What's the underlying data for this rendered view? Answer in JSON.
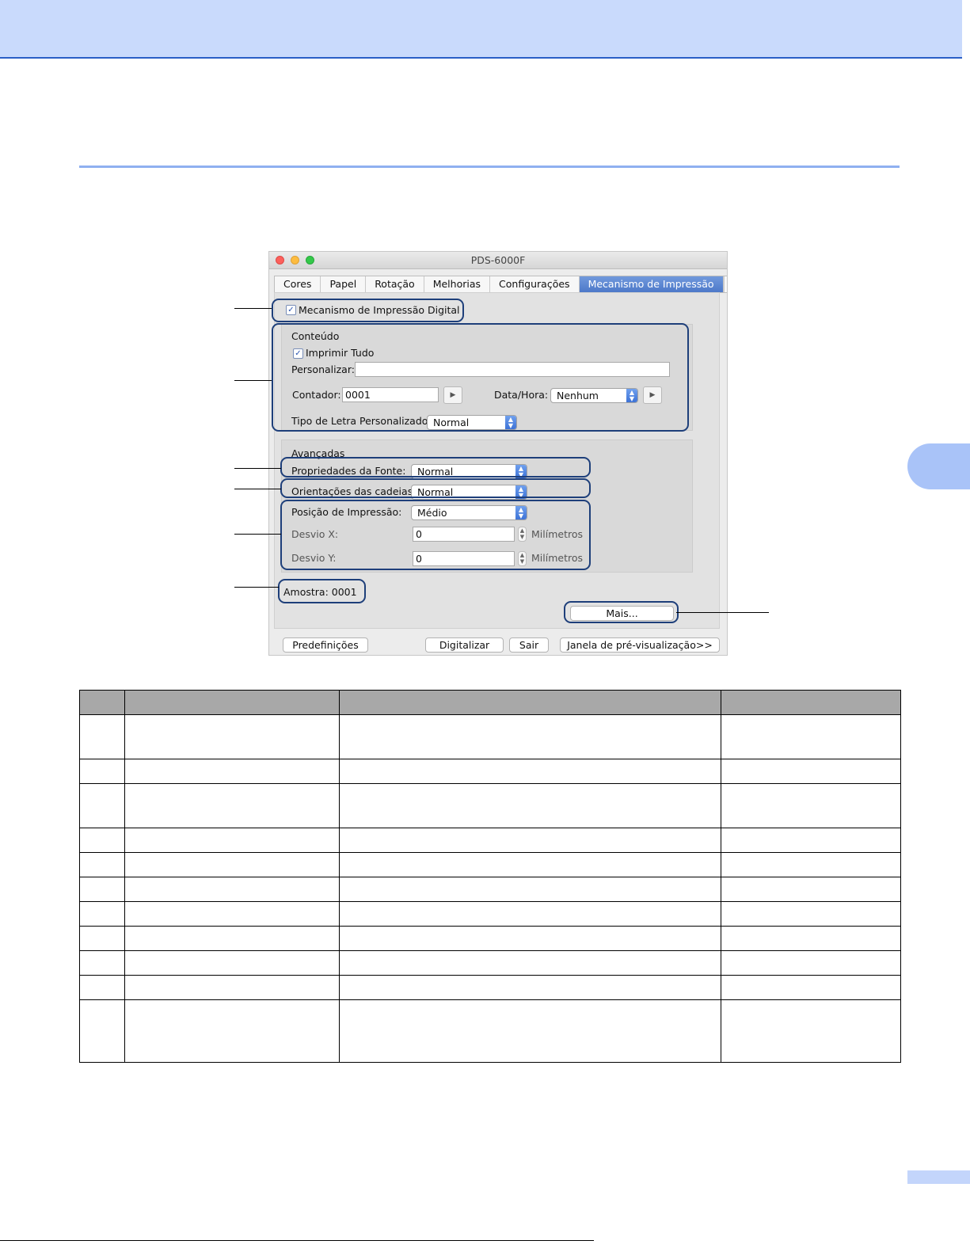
{
  "window": {
    "title": "PDS-6000F"
  },
  "tabs": [
    "Cores",
    "Papel",
    "Rotação",
    "Melhorias",
    "Configurações",
    "Mecanismo de Impressão"
  ],
  "active_tab": "Mecanismo de Impressão",
  "tab_nav": {
    "prev": "◀",
    "next": "▶"
  },
  "imprinter": {
    "enable_label": "Mecanismo de Impressão Digital",
    "enable_checked": true,
    "content": {
      "title": "Conteúdo",
      "print_all_label": "Imprimir Tudo",
      "print_all_checked": true,
      "custom_label": "Personalizar:",
      "custom_value": "",
      "counter_label": "Contador:",
      "counter_value": "0001",
      "datetime_label": "Data/Hora:",
      "datetime_value": "Nenhum",
      "font_label": "Tipo de Letra Personalizado:",
      "font_value": "Normal"
    },
    "advanced": {
      "title": "Avançadas",
      "font_props_label": "Propriedades da Fonte:",
      "font_props_value": "Normal",
      "orientation_label": "Orientações das cadeias:",
      "orientation_value": "Normal",
      "position_label": "Posição de Impressão:",
      "position_value": "Médio",
      "offset_x_label": "Desvio X:",
      "offset_x_value": "0",
      "offset_y_label": "Desvio Y:",
      "offset_y_value": "0",
      "unit": "Milímetros"
    },
    "sample": "Amostra:  0001",
    "more_button": "Mais..."
  },
  "footer_buttons": {
    "presets": "Predefinições",
    "scan": "Digitalizar",
    "quit": "Sair",
    "preview": "Janela de pré-visualização>>"
  },
  "table": {
    "header_color": "#a8a8a8",
    "rows": 11
  },
  "colors": {
    "top_band": "#c9dafc",
    "top_band_border": "#2a5fc7",
    "accent_rule": "#8fb0f0",
    "active_tab": "#4d79c9",
    "callout": "#1e3f7a"
  }
}
